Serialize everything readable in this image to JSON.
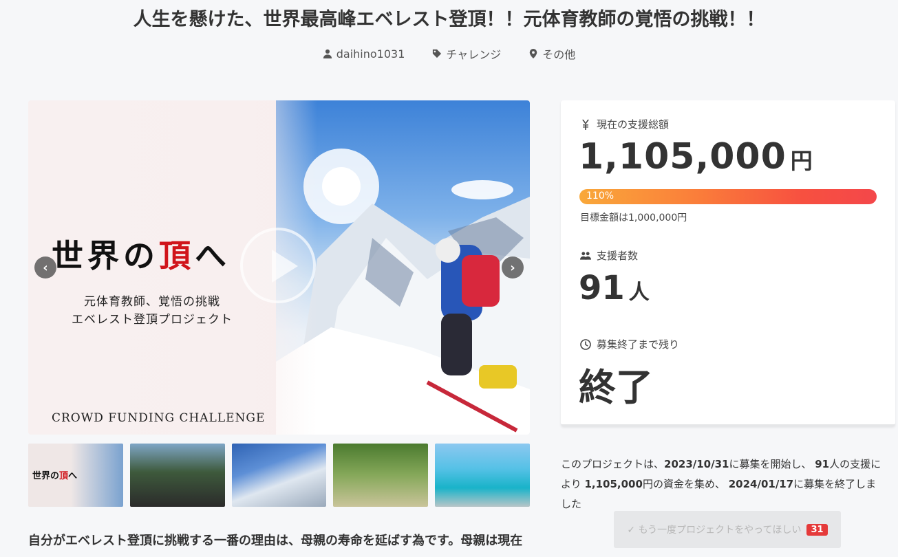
{
  "title": "人生を懸けた、世界最高峰エベレスト登頂！！元体育教師の覚悟の挑戦！！",
  "meta": {
    "author": "daihino1031",
    "category": "チャレンジ",
    "location": "その他"
  },
  "hero": {
    "headline_pre": "世界の",
    "headline_red": "頂",
    "headline_post": "へ",
    "subtitle_1": "元体育教師、覚悟の挑戦",
    "subtitle_2": "エベレスト登頂プロジェクト",
    "footer": "CROWD FUNDING CHALLENGE",
    "prev": "‹",
    "next": "›"
  },
  "thumbnail": {
    "headline_pre": "世界の",
    "headline_red": "頂",
    "headline_post": "へ"
  },
  "body_text": "自分がエベレスト登頂に挑戦する一番の理由は、母親の寿命を延ばす為です。母親は現在",
  "panel": {
    "total_label": "現在の支援総額",
    "total_amount": "1,105,000",
    "total_unit": "円",
    "progress_label": "110%",
    "progress_percent": 110,
    "goal_text": "目標金額は1,000,000円",
    "backers_label": "支援者数",
    "backers_count": "91",
    "backers_unit": "人",
    "remaining_label": "募集終了まで残り",
    "remaining_value": "終了"
  },
  "summary": {
    "t1": "このプロジェクトは、",
    "start_date": "2023/10/31",
    "t2": "に募集を開始し、 ",
    "backers": "91",
    "t3": "人の支援により ",
    "amount": "1,105,000",
    "t4": "円の資金を集め、 ",
    "end_date": "2024/01/17",
    "t5": "に募集を終了しました"
  },
  "again_button": {
    "label": "✓ もう一度プロジェクトをやってほしい",
    "count": "31"
  },
  "colors": {
    "progress_start": "#f9a83a",
    "progress_end": "#f4474a",
    "badge": "#e53a3a",
    "accent_red": "#d0141a"
  }
}
